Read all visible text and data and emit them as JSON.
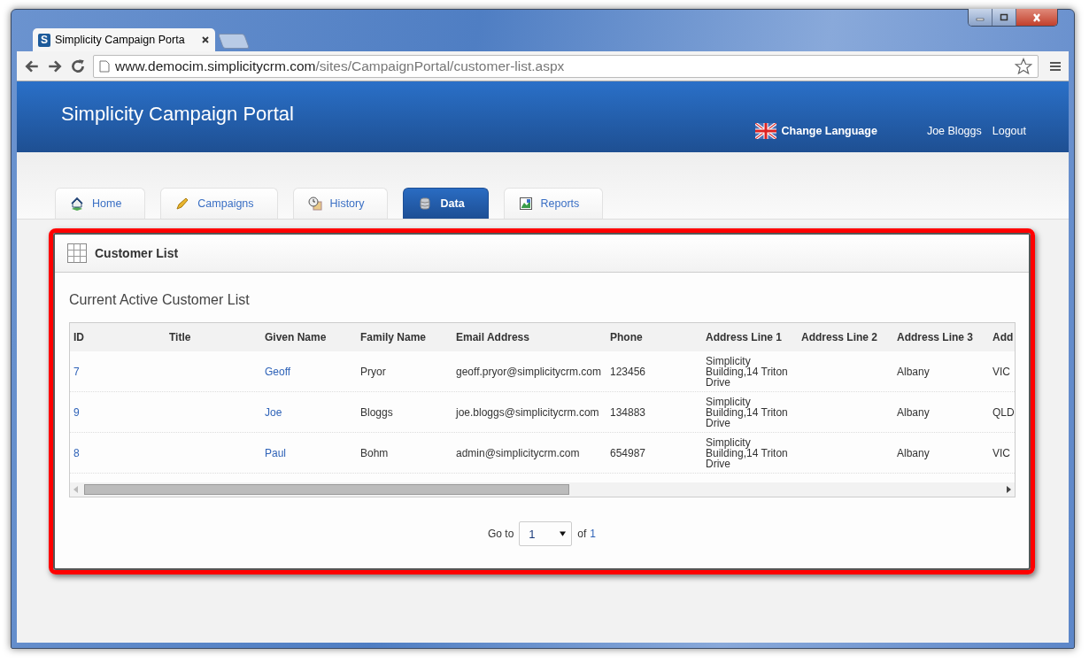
{
  "browser": {
    "favicon_letter": "S",
    "tab_title": "Simplicity Campaign Porta",
    "url_host": "www.democim.simplicitycrm.com",
    "url_path": "/sites/CampaignPortal/customer-list.aspx"
  },
  "header": {
    "title": "Simplicity Campaign Portal",
    "language_link": "Change Language",
    "user": "Joe Bloggs",
    "logout": "Logout"
  },
  "nav_tabs": [
    {
      "label": "Home",
      "selected": false
    },
    {
      "label": "Campaigns",
      "selected": false
    },
    {
      "label": "History",
      "selected": false
    },
    {
      "label": "Data",
      "selected": true
    },
    {
      "label": "Reports",
      "selected": false
    }
  ],
  "panel": {
    "title": "Customer List",
    "subtitle": "Current Active Customer List"
  },
  "table": {
    "columns": [
      "ID",
      "Title",
      "Given Name",
      "Family Name",
      "Email Address",
      "Phone",
      "Address Line 1",
      "Address Line 2",
      "Address Line 3",
      "Add"
    ],
    "rows": [
      [
        "7",
        "",
        "Geoff",
        "Pryor",
        "geoff.pryor@simplicitycrm.com",
        "123456",
        "Simplicity Building,14 Triton Drive",
        "",
        "Albany",
        "VIC"
      ],
      [
        "9",
        "",
        "Joe",
        "Bloggs",
        "joe.bloggs@simplicitycrm.com",
        "134883",
        "Simplicity Building,14 Triton Drive",
        "",
        "Albany",
        "QLD"
      ],
      [
        "8",
        "",
        "Paul",
        "Bohm",
        "admin@simplicitycrm.com",
        "654987",
        "Simplicity Building,14 Triton Drive",
        "",
        "Albany",
        "VIC"
      ]
    ]
  },
  "pager": {
    "label": "Go to",
    "page": "1",
    "of": "of",
    "total": "1"
  }
}
